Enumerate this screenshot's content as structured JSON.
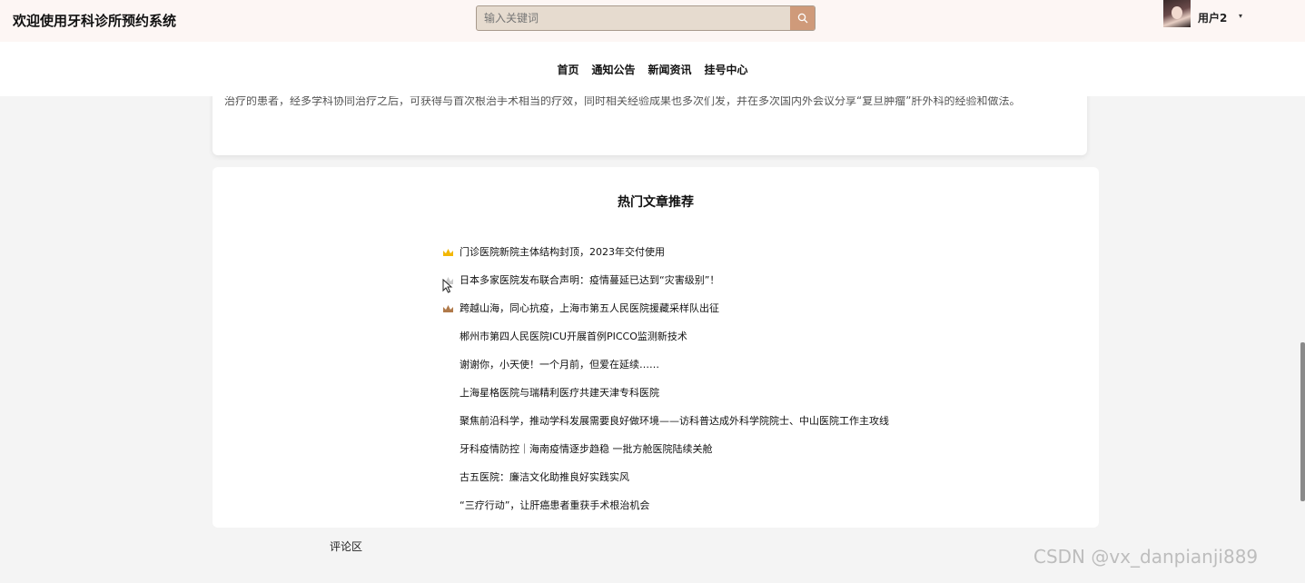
{
  "header": {
    "site_title": "欢迎使用牙科诊所预约系统",
    "search_placeholder": "输入关键词",
    "search_icon": "search-icon",
    "user_name": "用户2",
    "user_caret": "▾"
  },
  "nav": {
    "items": [
      "首页",
      "通知公告",
      "新闻资讯",
      "挂号中心"
    ]
  },
  "article": {
    "tail_text": "治疗的患者，经多学科协同治疗之后，可获得与首次根治手术相当的疗效，同时相关经验成果也多次们发，并在多次国内外会议分享“复旦肿瘤”肝外科的经验和做法。"
  },
  "hot": {
    "title": "热门文章推荐",
    "items": [
      {
        "text": "门诊医院新院主体结构封顶，2023年交付使用",
        "rank": "gold"
      },
      {
        "text": "日本多家医院发布联合声明：疫情蔓延已达到“灾害级别”！",
        "rank": "silver"
      },
      {
        "text": "跨越山海，同心抗疫，上海市第五人民医院援藏采样队出征",
        "rank": "bronze"
      },
      {
        "text": "郴州市第四人民医院ICU开展首例PICCO监测新技术",
        "rank": ""
      },
      {
        "text": "谢谢你，小天使！一个月前，但爱在延续……",
        "rank": ""
      },
      {
        "text": "上海星格医院与瑞精利医疗共建天津专科医院",
        "rank": ""
      },
      {
        "text": "聚焦前沿科学，推动学科发展需要良好做环境——访科普达成外科学院院士、中山医院工作主攻线",
        "rank": ""
      },
      {
        "text": "牙科疫情防控｜海南疫情逐步趋稳 一批方舱医院陆续关舱",
        "rank": ""
      },
      {
        "text": "古五医院：廉洁文化助推良好实践实风",
        "rank": ""
      },
      {
        "text": "“三疗行动”，让肝癌患者重获手术根治机会",
        "rank": ""
      }
    ]
  },
  "comment_label": "评论区",
  "watermark": "CSDN @vx_danpianji889",
  "colors": {
    "topbar": "#fdf6f4",
    "search_button": "#cf9a7a",
    "gold": "#f2b705",
    "silver": "#c9c9c9",
    "bronze": "#b07a4a"
  }
}
